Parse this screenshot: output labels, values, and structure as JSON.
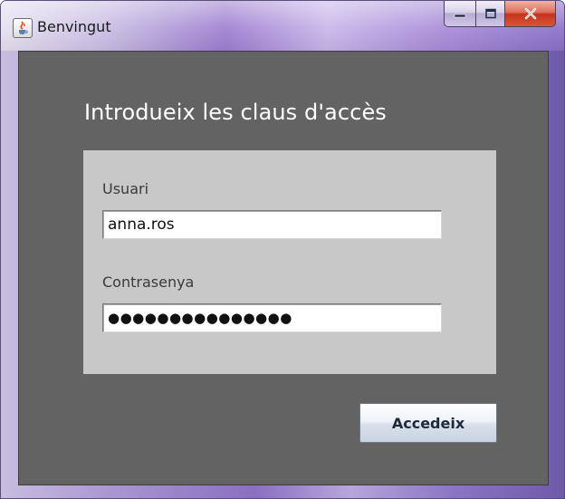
{
  "window": {
    "title": "Benvingut",
    "icon": "java-cup-icon",
    "controls": [
      "minimize-icon",
      "maximize-icon",
      "close-icon"
    ]
  },
  "login": {
    "heading": "Introdueix les claus d'accès",
    "username_label": "Usuari",
    "username_value": "anna.ros",
    "password_label": "Contrasenya",
    "password_mask": "●●●●●●●●●●●●●●●",
    "submit_label": "Accedeix"
  },
  "colors": {
    "client_background": "#636363",
    "panel_background": "#c8c8c8",
    "heading_text": "#ffffff"
  }
}
